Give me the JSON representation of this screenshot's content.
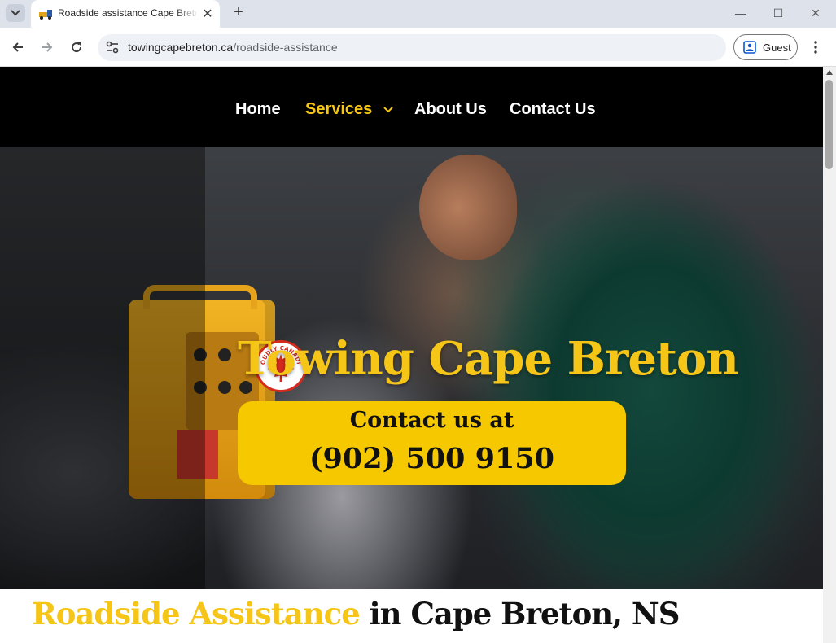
{
  "browser": {
    "tab_title": "Roadside assistance Cape Breton",
    "new_tab": "+",
    "tab_close": "✕",
    "url_domain": "towingcapebreton.ca",
    "url_path": "/roadside-assistance",
    "profile_label": "Guest",
    "window_controls": {
      "minimize": "—",
      "maximize": "☐",
      "close": "✕"
    }
  },
  "site": {
    "nav": [
      {
        "label": "Home",
        "active": false
      },
      {
        "label": "Services",
        "active": true,
        "has_dropdown": true
      },
      {
        "label": "About Us",
        "active": false
      },
      {
        "label": "Contact Us",
        "active": false
      }
    ],
    "hero": {
      "badge_text": "PROUDLY CANADIAN",
      "title": "Towing Cape Breton",
      "cta_line1": "Contact us at",
      "cta_phone": "(902) 500 9150"
    },
    "section_heading": {
      "highlight": "Roadside Assistance",
      "rest": " in Cape Breton, NS"
    }
  },
  "colors": {
    "accent_yellow": "#f5c518",
    "cta_yellow": "#f5c800",
    "nav_bg": "#000000",
    "maple_red": "#d52b1e"
  }
}
